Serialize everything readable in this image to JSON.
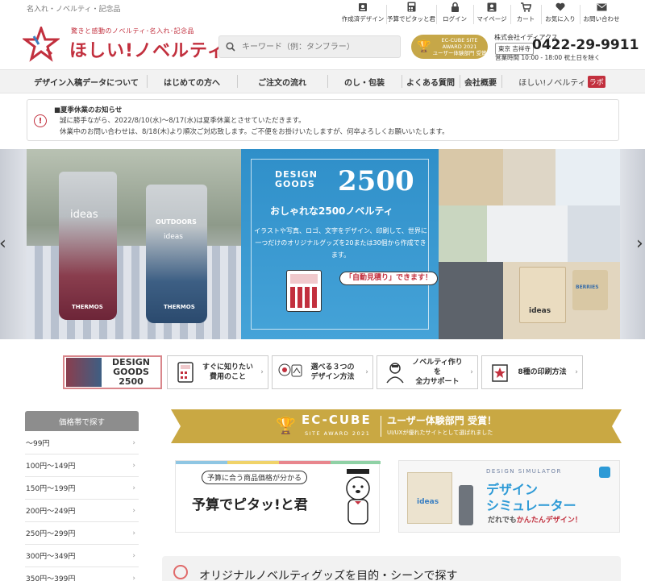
{
  "header": {
    "tagline": "名入れ・ノベルティ・記念品",
    "logo_sub": "驚きと感動のノベルティ･名入れ･記念品",
    "logo_main": "ほしい!ノベルティ",
    "search_placeholder": "キーワード（例：タンブラー）",
    "util_nav": [
      {
        "label": "作成済デザイン",
        "icon": "design-icon"
      },
      {
        "label": "予算でピタッと君",
        "icon": "calculator-icon"
      },
      {
        "label": "ログイン",
        "icon": "lock-icon"
      },
      {
        "label": "マイページ",
        "icon": "user-icon"
      },
      {
        "label": "カート",
        "icon": "cart-icon"
      },
      {
        "label": "お気に入り",
        "icon": "heart-icon"
      },
      {
        "label": "お問い合わせ",
        "icon": "mail-icon"
      }
    ],
    "award": {
      "line1": "EC-CUBE SITE",
      "line2": "AWARD 2021",
      "line3": "ユーザー体験部門 受賞"
    },
    "company": "株式会社イディアクス",
    "city": "東京 吉祥寺",
    "phone": "0422-29-9911",
    "hours": "営業時間 10:00 - 18:00 祝土日を除く"
  },
  "main_nav": [
    {
      "label": "デザイン入稿データについて"
    },
    {
      "label": "はじめての方へ"
    },
    {
      "label": "ご注文の流れ"
    },
    {
      "label": "のし・包装"
    },
    {
      "label": "よくある質問"
    },
    {
      "label": "会社概要"
    },
    {
      "label": "ほしい!ノベルティ",
      "tag": "ラボ"
    }
  ],
  "notice": {
    "title": "■夏季休業のお知らせ",
    "line1": "誠に勝手ながら、2022/8/10(水)～8/17(水)は夏季休業とさせていただきます。",
    "line2": "休業中のお問い合わせは、8/18(木)より順次ご対応致します。ご不便をお掛けいたしますが、何卒よろしくお願いいたします。"
  },
  "hero": {
    "design_small": [
      "DESIGN",
      "GOODS"
    ],
    "design_big": "2500",
    "subtitle": "おしゃれな2500ノベルティ",
    "desc": "イラストや写真、ロゴ、文字をデザイン、印刷して、世界に一つだけのオリジナルグッズを20または30個から作成できます。",
    "bubble": "「自動見積り」できます！",
    "bottle1_brand": "ideas",
    "bottle1_label": "THERMOS",
    "bottle2_brand": "OUTDOORS",
    "bottle2_sub": "ideas",
    "bottle2_label": "THERMOS",
    "tote_text": "ideas",
    "tote2_text": "BERRIES"
  },
  "features": [
    {
      "label": "DESIGN GOODS 2500",
      "icon": "design-goods-icon"
    },
    {
      "label": "すぐに知りたい\n費用のこと",
      "icon": "calculator-icon"
    },
    {
      "label": "選べる３つの\nデザイン方法",
      "icon": "design-method-icon"
    },
    {
      "label": "ノベルティ作りを\n全力サポート",
      "icon": "support-icon"
    },
    {
      "label": "8種の印刷方法",
      "icon": "print-icon"
    }
  ],
  "sidebar": {
    "heading": "価格帯で探す",
    "prices": [
      "～99円",
      "100円～149円",
      "150円～199円",
      "200円～249円",
      "250円～299円",
      "300円～349円",
      "350円～399円"
    ]
  },
  "ribbon": {
    "ec": "EC-CUBE",
    "site_award": "SITE AWARD 2021",
    "user_award": "ユーザー体験部門 受賞！",
    "ux_note": "UI/UXが優れたサイトとして選ばれました"
  },
  "banner_budget": {
    "sub": "予算に合う商品価格が分かる",
    "title": "予算でピタッ!と君"
  },
  "banner_sim": {
    "label": "DESIGN SIMULATOR",
    "line1": "デザイン",
    "line2": "シミュレーター",
    "line3_a": "だれでも",
    "line3_b": "かんたんデザイン！",
    "tote_text": "ideas"
  },
  "bottom_heading": "オリジナルノベルティグッズを目的・シーンで探す",
  "colors": {
    "brand": "#c2303e",
    "gold": "#c9a843",
    "blue": "#2d9ad6"
  }
}
